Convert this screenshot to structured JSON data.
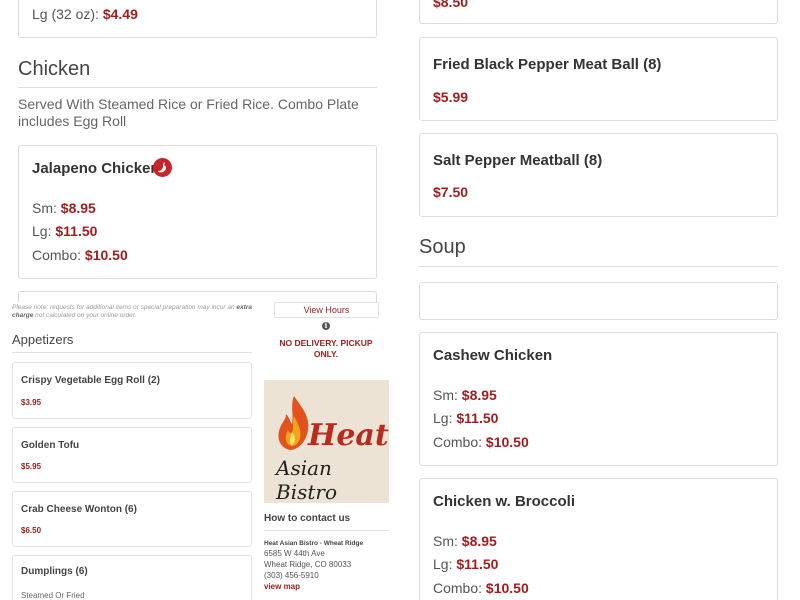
{
  "left_column": {
    "top_card_size_label": "Lg (32 oz):",
    "top_card_price": "$4.49",
    "chicken_section": {
      "title": "Chicken",
      "description": "Served With Steamed Rice or Fried Rice. Combo Plate includes Egg Roll",
      "item": {
        "name": "Jalapeno Chicken",
        "prices": [
          {
            "label": "Sm:",
            "value": "$8.95"
          },
          {
            "label": "Lg:",
            "value": "$11.50"
          },
          {
            "label": "Combo:",
            "value": "$10.50"
          }
        ]
      }
    }
  },
  "right_column": {
    "top_card_price": "$8.50",
    "items": [
      {
        "name": "Fried Black Pepper Meat Ball (8)",
        "price": "$5.99"
      },
      {
        "name": "Salt Pepper Meatball (8)",
        "price": "$7.50"
      }
    ],
    "soup_section": {
      "title": "Soup"
    },
    "soup_items": [
      {
        "name": "Cashew Chicken",
        "prices": [
          {
            "label": "Sm:",
            "value": "$8.95"
          },
          {
            "label": "Lg:",
            "value": "$11.50"
          },
          {
            "label": "Combo:",
            "value": "$10.50"
          }
        ]
      },
      {
        "name": "Chicken w. Broccoli",
        "prices": [
          {
            "label": "Sm:",
            "value": "$8.95"
          },
          {
            "label": "Lg:",
            "value": "$11.50"
          },
          {
            "label": "Combo:",
            "value": "$10.50"
          }
        ]
      }
    ]
  },
  "order_panel": {
    "note_prefix": "Please note: requests for additional items or special preparation may incur an",
    "note_bold": "extra charge",
    "note_suffix": "not calculated on your online order.",
    "appetizers_title": "Appetizers",
    "appetizers": [
      {
        "name": "Crispy Vegetable Egg Roll (2)",
        "price": "$3.95"
      },
      {
        "name": "Golden Tofu",
        "price": "$5.95"
      },
      {
        "name": "Crab Cheese Wonton (6)",
        "price": "$6.50"
      },
      {
        "name": "Dumplings (6)",
        "description": "Steamed Or Fried"
      }
    ],
    "view_hours": "View Hours",
    "delivery_notice": "NO DELIVERY. PICKUP ONLY.",
    "logo_heat": "Heat",
    "logo_sub": "Asian Bistro",
    "contact_title": "How to contact us",
    "contact_name": "Heat Asian Bistro - Wheat Ridge",
    "address_line1": "6585 W 44th Ave",
    "address_line2": "Wheat Ridge, CO 80033",
    "phone": "(303) 456-5910",
    "view_map": "view map"
  },
  "icons": {
    "spicy": "chili-icon",
    "info": "info-icon",
    "flame": "flame-icon"
  },
  "colors": {
    "price": "#a01e1e",
    "chili_badge": "#c4262b"
  }
}
